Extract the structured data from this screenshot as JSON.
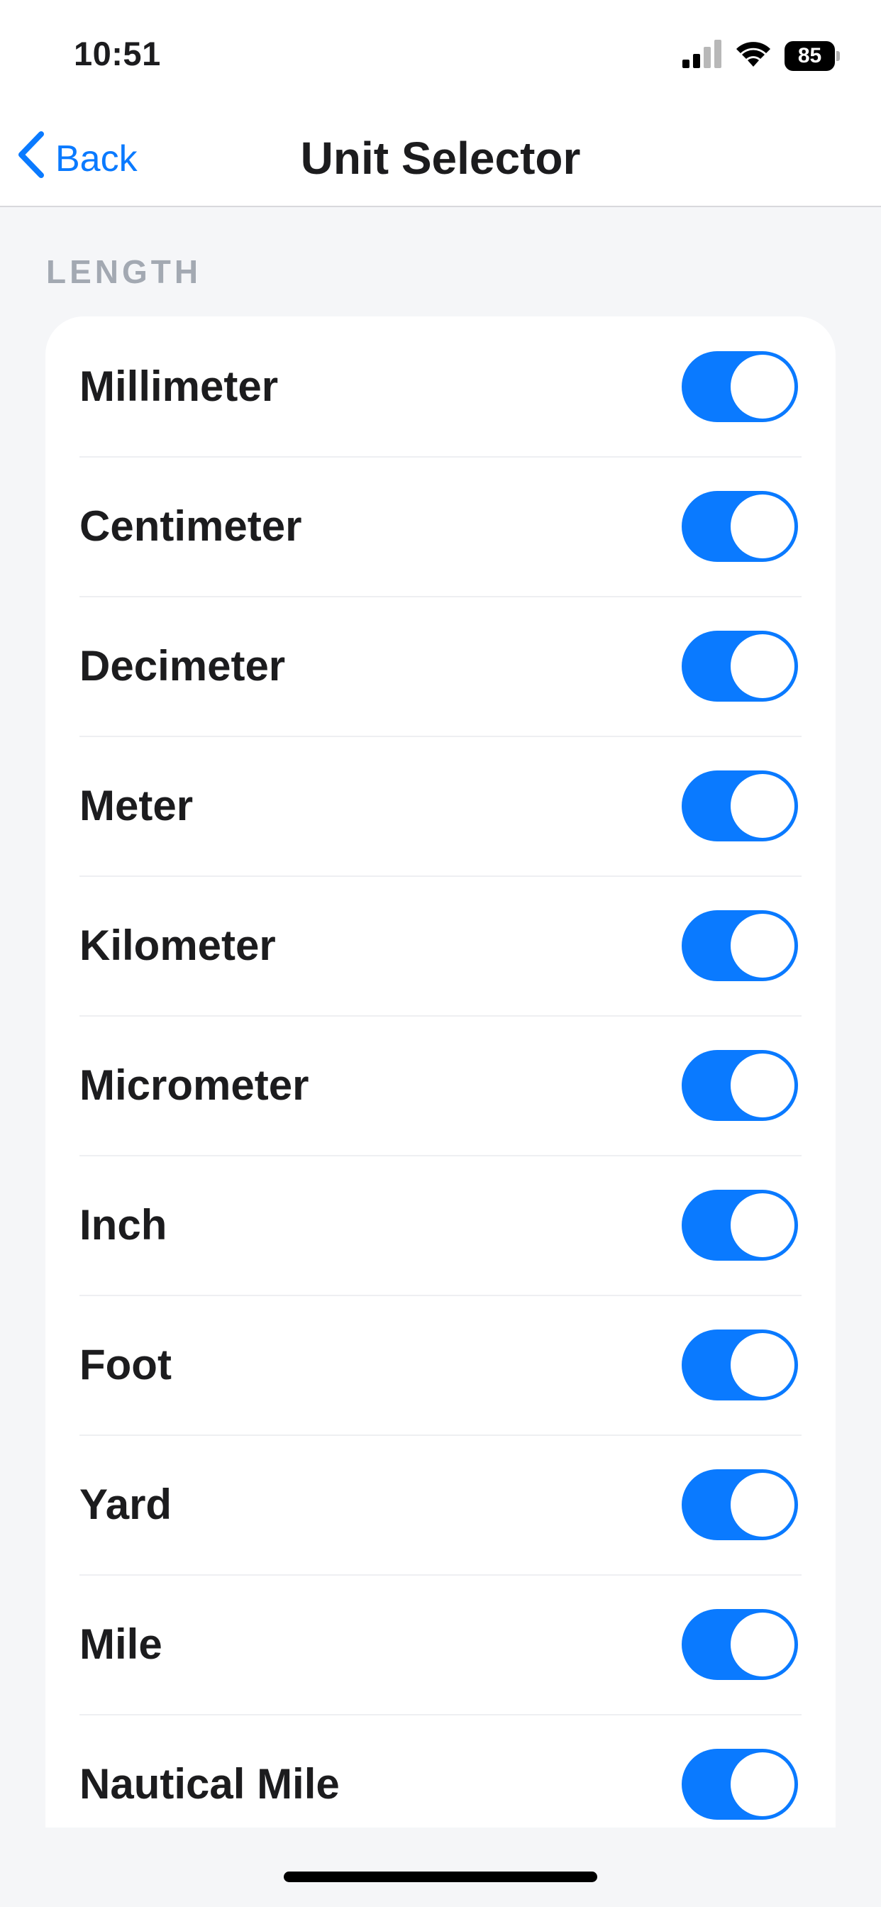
{
  "status_bar": {
    "time": "10:51",
    "battery": "85",
    "icons": [
      "signal-icon",
      "wifi-icon",
      "battery-icon"
    ]
  },
  "nav": {
    "back_label": "Back",
    "title": "Unit Selector"
  },
  "section": {
    "header": "LENGTH"
  },
  "units": [
    {
      "label": "Millimeter",
      "enabled": true
    },
    {
      "label": "Centimeter",
      "enabled": true
    },
    {
      "label": "Decimeter",
      "enabled": true
    },
    {
      "label": "Meter",
      "enabled": true
    },
    {
      "label": "Kilometer",
      "enabled": true
    },
    {
      "label": "Micrometer",
      "enabled": true
    },
    {
      "label": "Inch",
      "enabled": true
    },
    {
      "label": "Foot",
      "enabled": true
    },
    {
      "label": "Yard",
      "enabled": true
    },
    {
      "label": "Mile",
      "enabled": true
    },
    {
      "label": "Nautical Mile",
      "enabled": true
    }
  ],
  "colors": {
    "accent": "#0a7aff",
    "background": "#f5f6f8",
    "card": "#ffffff",
    "section_header": "#a3a9b2",
    "text": "#1c1c1e"
  }
}
